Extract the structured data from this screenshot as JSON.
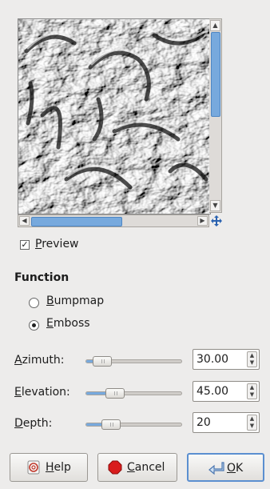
{
  "preview": {
    "checkbox_checked": true,
    "label": "Preview",
    "label_mnemonic": "P",
    "label_rest": "review"
  },
  "function": {
    "heading": "Function",
    "options": [
      {
        "mnemonic": "B",
        "rest": "umpmap",
        "label": "Bumpmap",
        "selected": false
      },
      {
        "mnemonic": "E",
        "rest": "mboss",
        "label": "Emboss",
        "selected": true
      }
    ]
  },
  "sliders": [
    {
      "label": "Azimuth:",
      "mnemonic": "A",
      "rest": "zimuth:",
      "value": "30.00",
      "fraction": 0.083
    },
    {
      "label": "Elevation:",
      "mnemonic": "E",
      "rest": "levation:",
      "value": "45.00",
      "fraction": 0.25
    },
    {
      "label": "Depth:",
      "mnemonic": "D",
      "rest": "epth:",
      "value": "20",
      "fraction": 0.2
    }
  ],
  "buttons": {
    "help": {
      "mnemonic": "H",
      "rest": "elp",
      "label": "Help"
    },
    "cancel": {
      "mnemonic": "C",
      "rest": "ancel",
      "label": "Cancel"
    },
    "ok": {
      "mnemonic": "O",
      "rest": "K",
      "label": "OK"
    }
  },
  "colors": {
    "accent": "#77a9dd",
    "cancel_icon": "#d91c1c",
    "ok_icon": "#5b8fd0"
  },
  "icons": {
    "navigate": "move-arrows-icon",
    "help": "help-icon",
    "cancel": "stop-icon",
    "ok": "enter-arrow-icon"
  }
}
